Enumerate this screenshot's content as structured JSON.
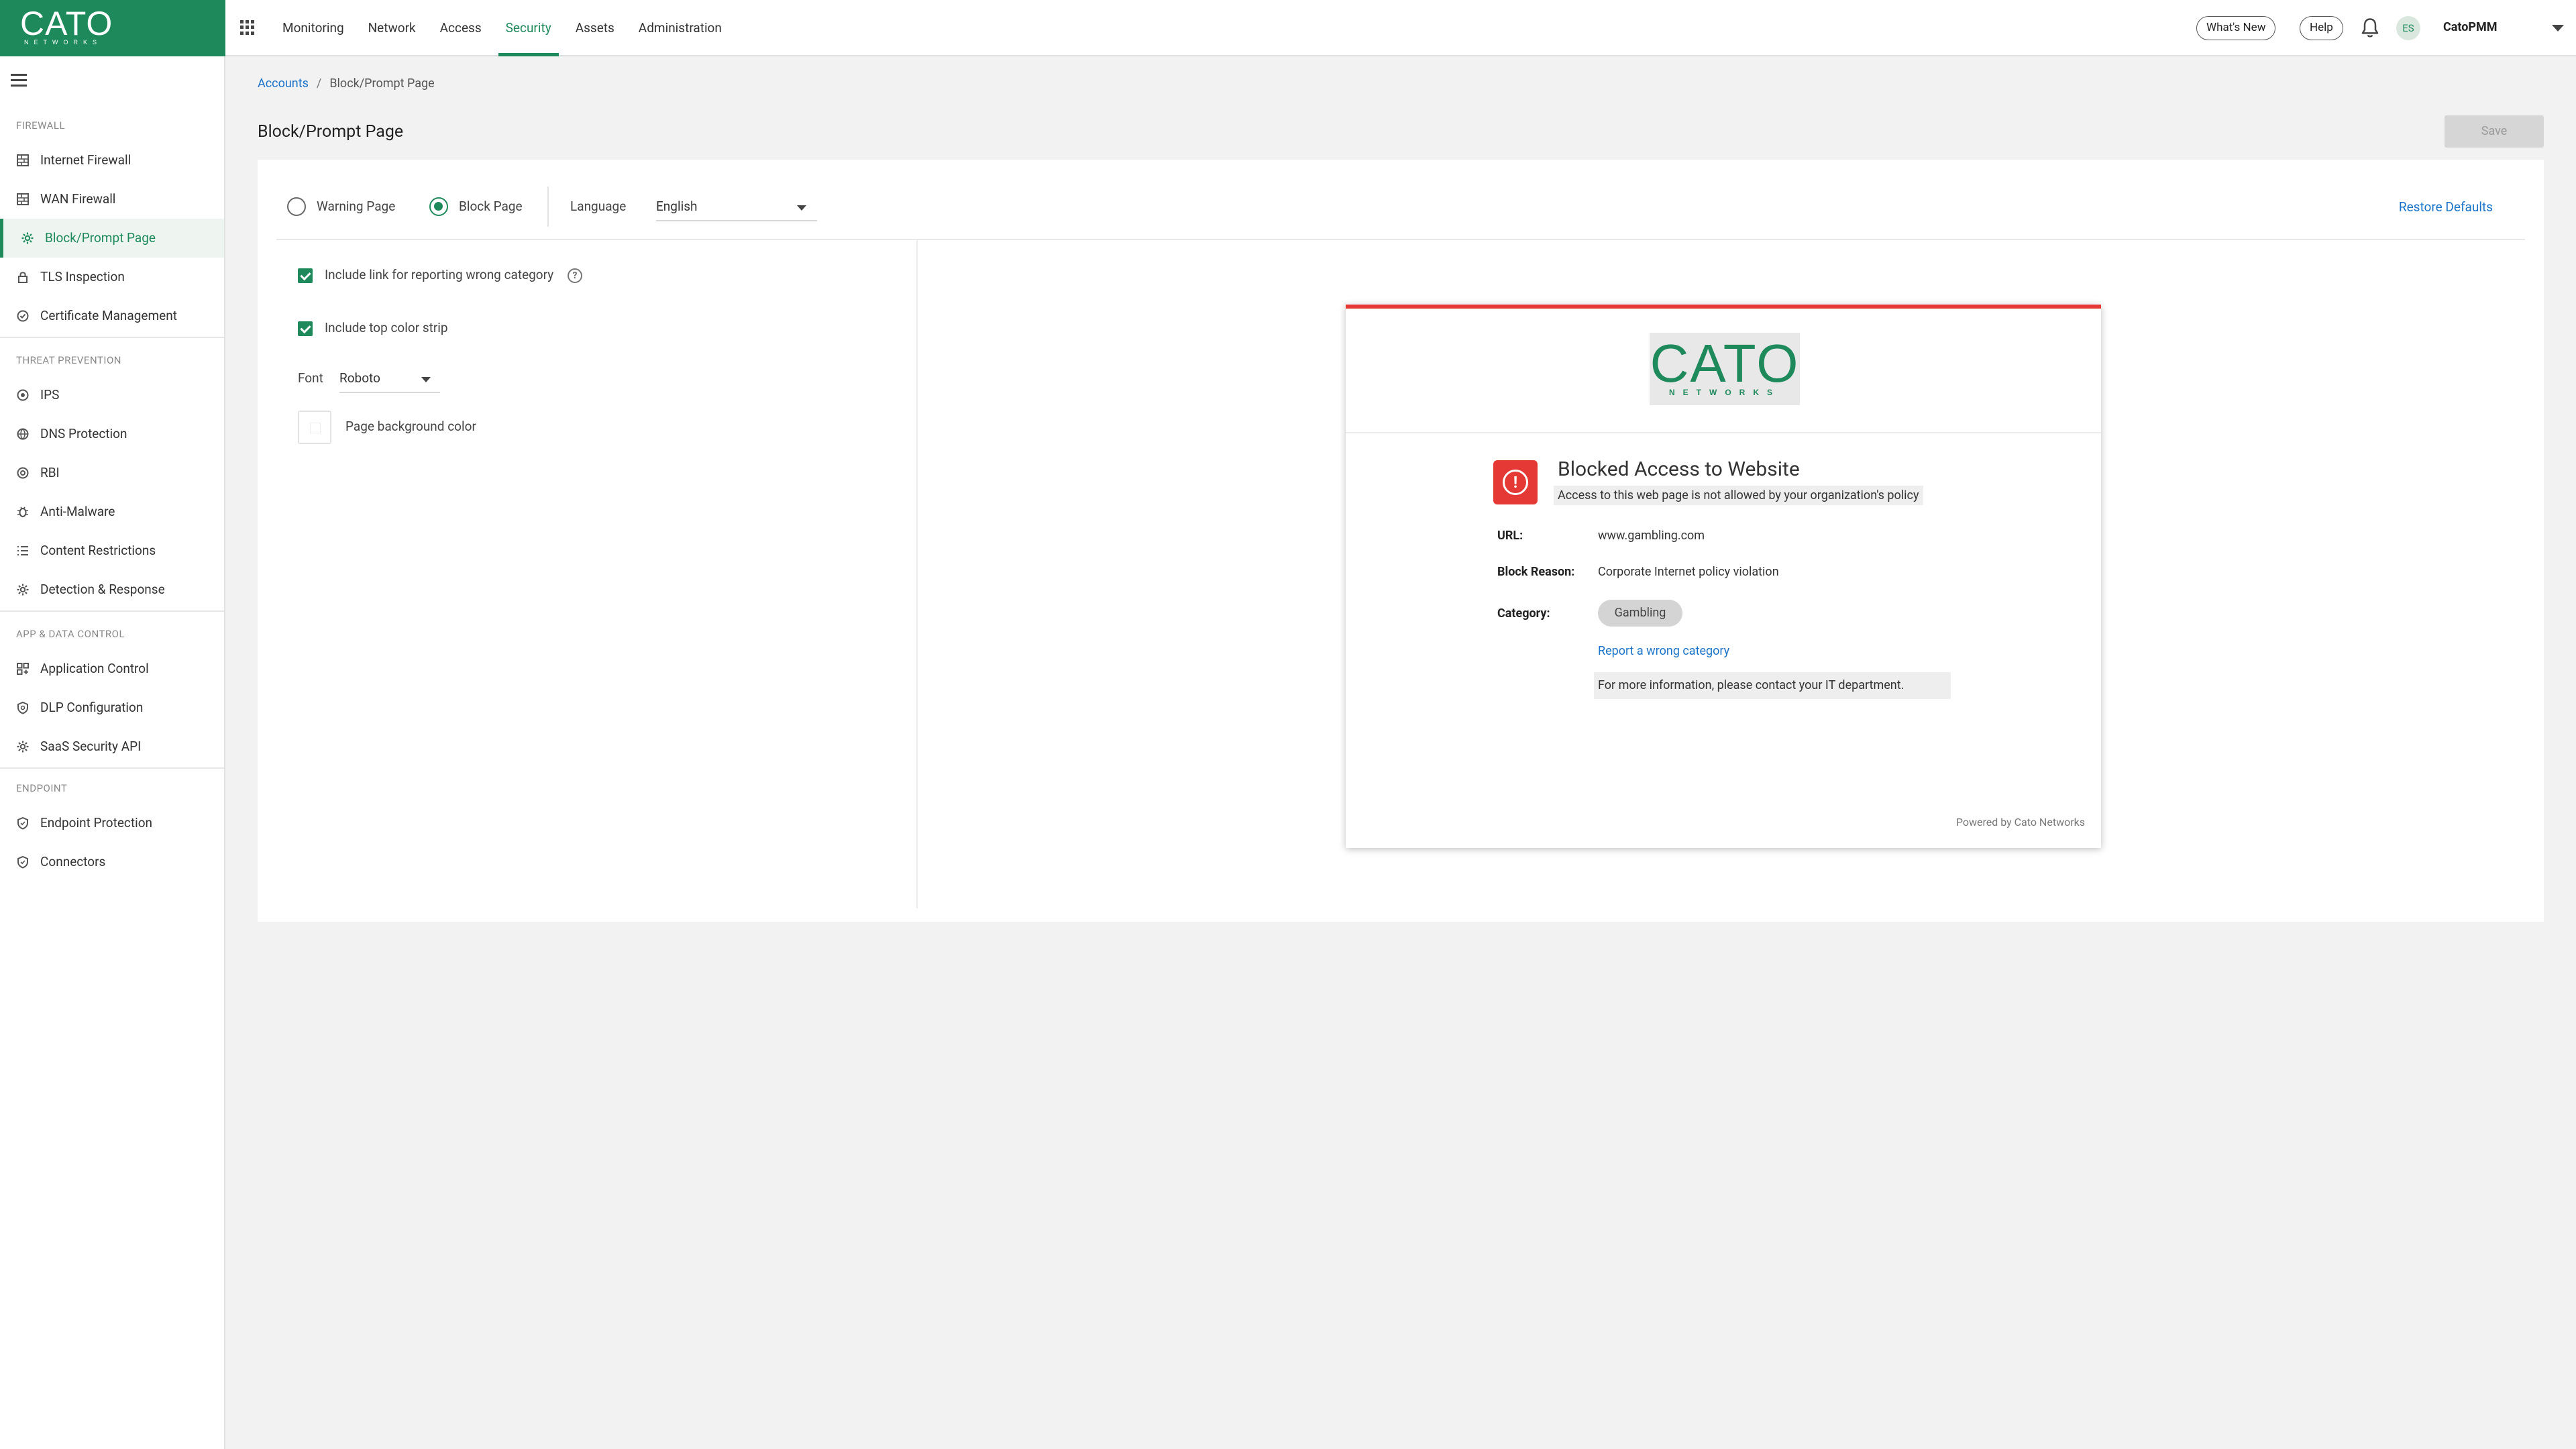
{
  "brand": {
    "logo_main": "CATO",
    "logo_sub": "NETWORKS"
  },
  "topnav": {
    "items": [
      {
        "label": "Monitoring"
      },
      {
        "label": "Network"
      },
      {
        "label": "Access"
      },
      {
        "label": "Security",
        "active": true
      },
      {
        "label": "Assets"
      },
      {
        "label": "Administration"
      }
    ],
    "whats_new": "What's New",
    "help": "Help",
    "avatar_initials": "ES",
    "account": "CatoPMM"
  },
  "sidebar": {
    "sections": [
      {
        "title": "FIREWALL",
        "items": [
          {
            "label": "Internet Firewall",
            "icon": "firewall-icon"
          },
          {
            "label": "WAN Firewall",
            "icon": "firewall-icon"
          },
          {
            "label": "Block/Prompt Page",
            "icon": "gear-icon",
            "active": true
          },
          {
            "label": "TLS Inspection",
            "icon": "lock-icon"
          },
          {
            "label": "Certificate Management",
            "icon": "certificate-icon"
          }
        ]
      },
      {
        "title": "THREAT PREVENTION",
        "items": [
          {
            "label": "IPS",
            "icon": "target-icon"
          },
          {
            "label": "DNS Protection",
            "icon": "globe-icon"
          },
          {
            "label": "RBI",
            "icon": "target-icon"
          },
          {
            "label": "Anti-Malware",
            "icon": "bug-icon"
          },
          {
            "label": "Content Restrictions",
            "icon": "list-icon"
          },
          {
            "label": "Detection & Response",
            "icon": "gear-icon"
          }
        ]
      },
      {
        "title": "APP & DATA CONTROL",
        "items": [
          {
            "label": "Application Control",
            "icon": "apps-icon"
          },
          {
            "label": "DLP Configuration",
            "icon": "shield-icon"
          },
          {
            "label": "SaaS Security API",
            "icon": "gear-icon"
          }
        ]
      },
      {
        "title": "ENDPOINT",
        "items": [
          {
            "label": "Endpoint Protection",
            "icon": "shield-icon"
          },
          {
            "label": "Connectors",
            "icon": "shield-icon"
          }
        ]
      }
    ]
  },
  "breadcrumb": {
    "root": "Accounts",
    "separator": "/",
    "current": "Block/Prompt Page"
  },
  "page": {
    "title": "Block/Prompt Page",
    "save": "Save"
  },
  "options": {
    "warning_page": "Warning Page",
    "block_page": "Block Page",
    "selected_mode": "Block Page",
    "language_label": "Language",
    "language_value": "English",
    "restore_defaults": "Restore Defaults"
  },
  "settings": {
    "include_report_link": "Include link for reporting wrong category",
    "include_report_link_checked": true,
    "include_color_strip": "Include top color strip",
    "include_color_strip_checked": true,
    "font_label": "Font",
    "font_value": "Roboto",
    "bg_color_label": "Page background color",
    "help_glyph": "?"
  },
  "preview": {
    "strip_color": "#e53935",
    "logo_main": "CATO",
    "logo_sub": "NETWORKS",
    "alert_glyph": "!",
    "title": "Blocked Access to Website",
    "subtitle": "Access to this web page is not allowed by your organization's policy",
    "url_label": "URL:",
    "url_value": "www.gambling.com",
    "reason_label": "Block Reason:",
    "reason_value": "Corporate Internet policy violation",
    "category_label": "Category:",
    "category_value": "Gambling",
    "report_link": "Report a wrong category",
    "info": "For more information, please contact your IT department.",
    "footer": "Powered by Cato Networks"
  },
  "colors": {
    "brand_green": "#1e8a5c",
    "link_blue": "#1a73c8",
    "alert_red": "#e53935"
  }
}
